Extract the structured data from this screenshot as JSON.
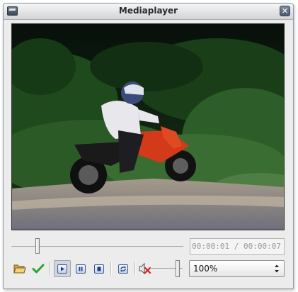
{
  "window": {
    "title": "Mediaplayer",
    "close_glyph": "✕",
    "app_icon": "mediaplayer-app-icon"
  },
  "playback": {
    "time_display": "00:00:01 / 00:00:07",
    "position_fraction": 0.143
  },
  "toolbar": {
    "open_icon": "folder-open-icon",
    "apply_icon": "green-checkmark-icon",
    "play_icon": "play-icon",
    "pause_icon": "pause-icon",
    "stop_icon": "stop-icon",
    "repeat_icon": "repeat-icon",
    "mute_icon": "speaker-muted-icon",
    "play_pressed": true
  },
  "volume": {
    "level_fraction": 0.9
  },
  "zoom": {
    "selected": "100%"
  },
  "colors": {
    "accent_blue": "#3d5a8f",
    "check_green": "#2fa32f",
    "mute_red": "#d42020",
    "video_background": "#0b1208"
  }
}
